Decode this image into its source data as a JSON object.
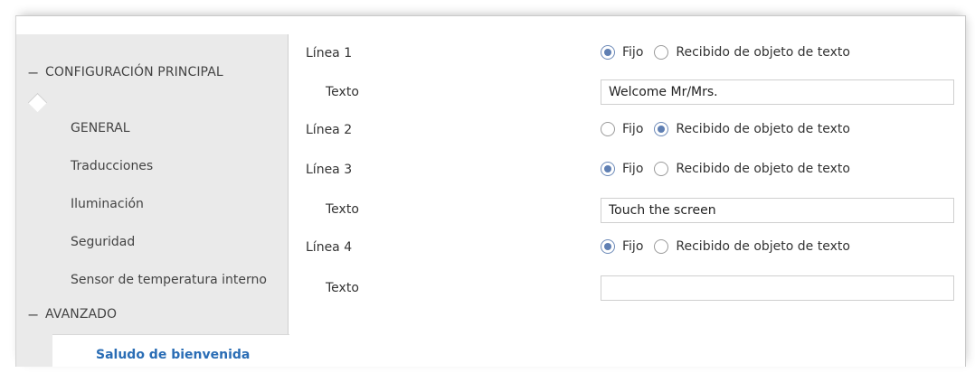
{
  "sidebar": {
    "main_group": "CONFIGURACIÓN PRINCIPAL",
    "items": [
      "GENERAL",
      "Traducciones",
      "Iluminación",
      "Seguridad",
      "Sensor de temperatura interno"
    ],
    "advanced_group": "AVANZADO",
    "active_item": "Saludo de bienvenida"
  },
  "form": {
    "linea1": {
      "label": "Línea 1",
      "selected": "Fijo"
    },
    "texto1": {
      "label": "Texto",
      "value": "Welcome Mr/Mrs."
    },
    "linea2": {
      "label": "Línea 2",
      "selected": "Recibido de objeto de texto"
    },
    "linea3": {
      "label": "Línea 3",
      "selected": "Fijo"
    },
    "texto3": {
      "label": "Texto",
      "value": "Touch the screen"
    },
    "linea4": {
      "label": "Línea 4",
      "selected": "Fijo"
    },
    "texto4": {
      "label": "Texto",
      "value": ""
    },
    "option_fixed": "Fijo",
    "option_received": "Recibido de objeto de texto"
  },
  "colors": {
    "active_link": "#2a6db5",
    "sidebar_bg": "#eaeaea",
    "radio_dot": "#5f7fb3"
  }
}
